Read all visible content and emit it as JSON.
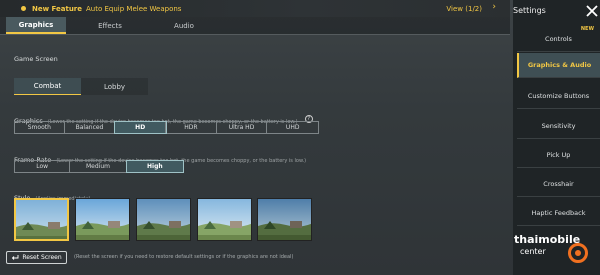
{
  "banner": {
    "lead": "New Feature",
    "text": "Auto Equip Melee Weapons",
    "view": "View (1/2)"
  },
  "tabs": [
    {
      "label": "Graphics"
    },
    {
      "label": "Effects"
    },
    {
      "label": "Audio"
    }
  ],
  "sidebar": {
    "title": "Settings",
    "items": [
      {
        "label": "Controls",
        "badge": "NEW"
      },
      {
        "label": "Graphics & Audio"
      },
      {
        "label": "Customize Buttons"
      },
      {
        "label": "Sensitivity"
      },
      {
        "label": "Pick Up"
      },
      {
        "label": "Crosshair"
      },
      {
        "label": "Haptic Feedback"
      }
    ]
  },
  "game_screen": {
    "label": "Game Screen",
    "options": [
      "Combat",
      "Lobby"
    ],
    "selected": "Combat"
  },
  "graphics": {
    "label": "Graphics",
    "hint": "(Lower the setting if the device becomes too hot, the game becomes choppy, or the battery is low.)",
    "options": [
      "Smooth",
      "Balanced",
      "HD",
      "HDR",
      "Ultra HD",
      "UHD"
    ],
    "selected": "HD"
  },
  "frame_rate": {
    "label": "Frame Rate",
    "hint": "(Lower the setting if the device becomes too hot, the game becomes choppy, or the battery is low.)",
    "options": [
      "Low",
      "Medium",
      "High"
    ],
    "selected": "High"
  },
  "style": {
    "label": "Style",
    "hint": "(Applies immediately)",
    "selected_index": 0
  },
  "reset": {
    "label": "Reset Screen",
    "note": "(Reset the screen if you need to restore default settings or if the graphics are not ideal)"
  },
  "watermark": {
    "line1": "thaimobile",
    "line2": "center"
  },
  "colors": {
    "accent": "#f2c744",
    "selected_bg": "#415a60"
  }
}
